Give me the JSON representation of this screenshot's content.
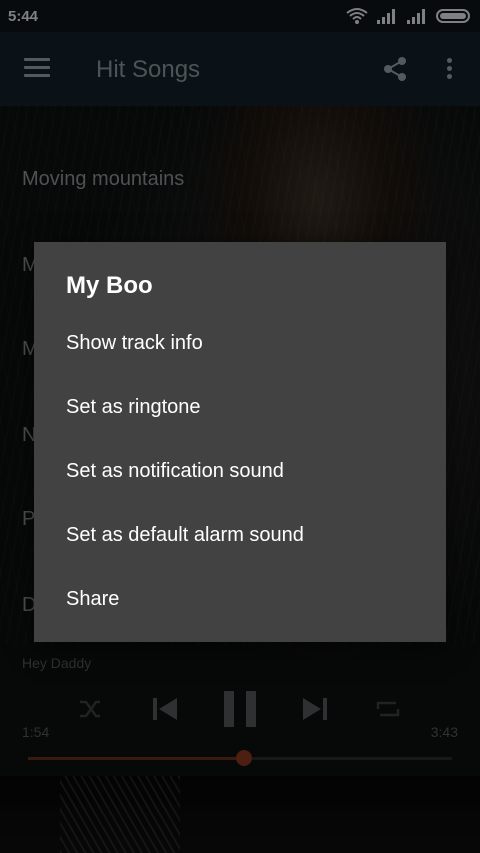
{
  "status_bar": {
    "time": "5:44"
  },
  "toolbar": {
    "title": "Hit Songs"
  },
  "songs": [
    {
      "label": "Moving mountains"
    },
    {
      "label": "M"
    },
    {
      "label": "M"
    },
    {
      "label": "N"
    },
    {
      "label": "P"
    },
    {
      "label": "D"
    }
  ],
  "player": {
    "now_playing": "Hey Daddy",
    "elapsed": "1:54",
    "total": "3:43",
    "progress_fraction": 0.51
  },
  "dialog": {
    "title": "My Boo",
    "options": [
      {
        "label": "Show track info"
      },
      {
        "label": "Set as ringtone"
      },
      {
        "label": "Set as notification sound"
      },
      {
        "label": "Set as default alarm sound"
      },
      {
        "label": "Share"
      }
    ]
  },
  "colors": {
    "toolbar": "#14222b",
    "dialog": "#424242",
    "accent": "#8a3a1f"
  }
}
